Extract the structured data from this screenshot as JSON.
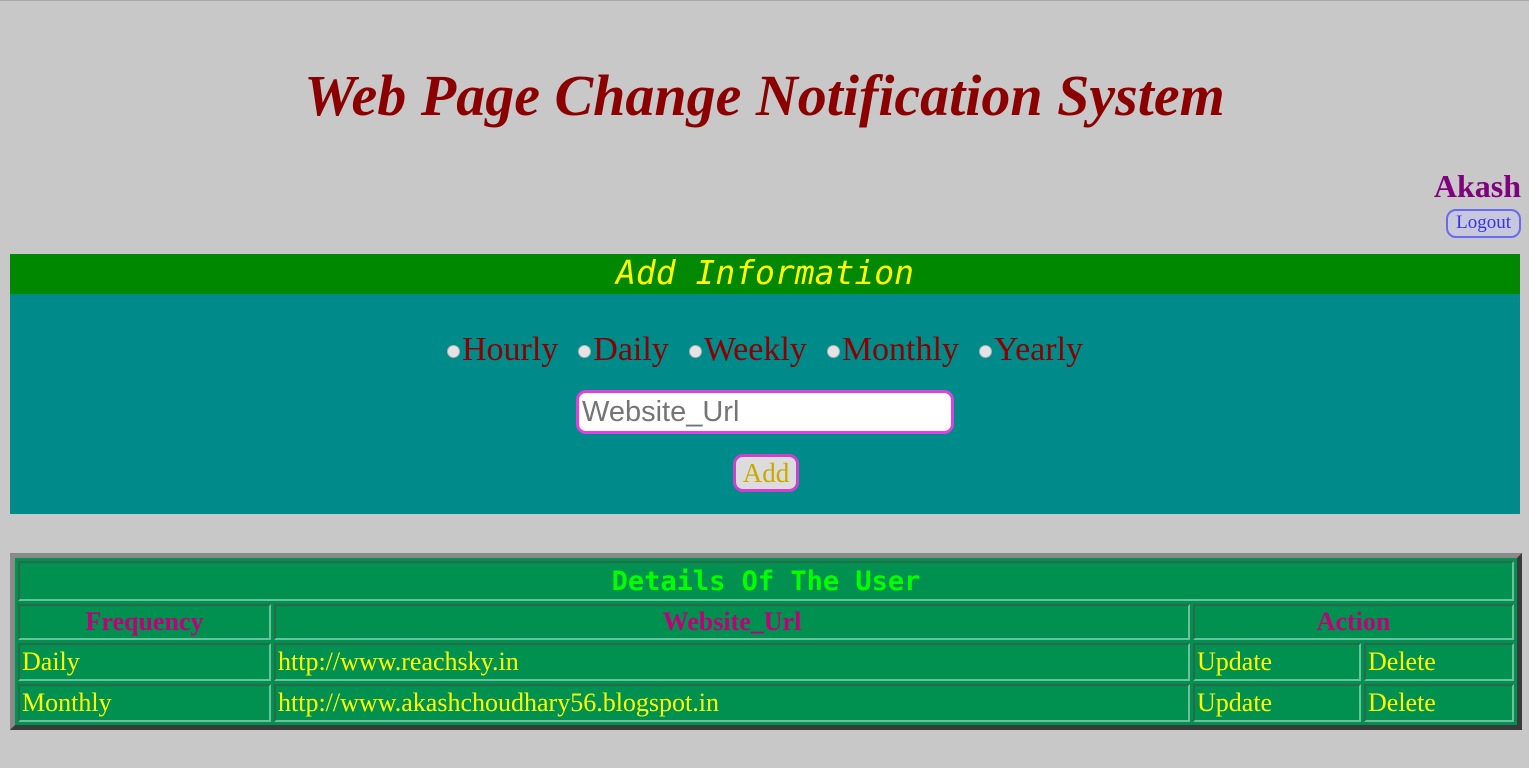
{
  "header": {
    "title": "Web Page Change Notification System"
  },
  "user": {
    "name": "Akash",
    "logout_label": "Logout"
  },
  "add_panel": {
    "title": "Add Information",
    "frequencies": [
      "Hourly",
      "Daily",
      "Weekly",
      "Monthly",
      "Yearly"
    ],
    "url_placeholder": "Website_Url",
    "add_label": "Add"
  },
  "details": {
    "title": "Details Of The User",
    "columns": [
      "Frequency",
      "Website_Url",
      "Action"
    ],
    "rows": [
      {
        "frequency": "Daily",
        "url": "http://www.reachsky.in",
        "update": "Update",
        "delete": "Delete"
      },
      {
        "frequency": "Monthly",
        "url": "http://www.akashchoudhary56.blogspot.in",
        "update": "Update",
        "delete": "Delete"
      }
    ]
  },
  "colors": {
    "background": "#c8c8c8",
    "title": "#8b0000",
    "user_name": "#800080",
    "panel_header": "#008800",
    "panel_body": "#008b8b",
    "table_body": "#009150",
    "table_title": "#00ff00",
    "table_header_text": "#c0007a",
    "table_cell_text": "#ffff00"
  }
}
